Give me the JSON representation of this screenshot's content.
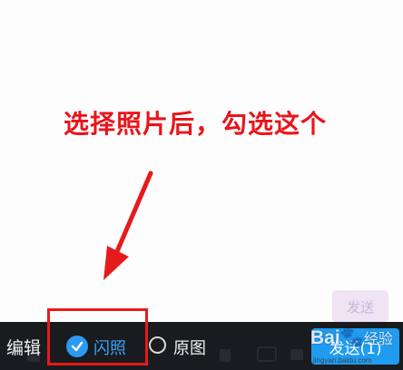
{
  "annotation": {
    "instruction": "选择照片后，勾选这个",
    "color": "#e8151b"
  },
  "compose": {
    "send_ghost_label": "发送"
  },
  "toolbar": {
    "edit_label": "编辑",
    "flash_label": "闪照",
    "flash_checked": true,
    "original_label": "原图",
    "original_checked": false,
    "send_label": "发送(1)",
    "accent_color": "#2b9af3",
    "bar_color": "#1a1b1f"
  },
  "watermark": {
    "logo_text": "Bai",
    "logo_suffix": "经验",
    "url": "jingyan.baidu.com"
  }
}
